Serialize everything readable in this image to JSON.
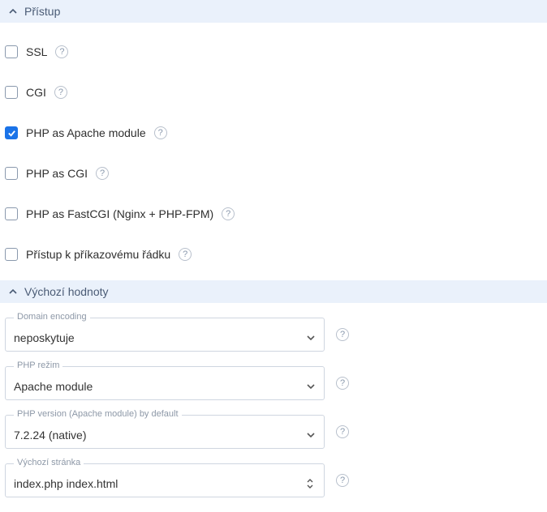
{
  "sections": {
    "access": {
      "title": "Přístup"
    },
    "defaults": {
      "title": "Výchozí hodnoty"
    }
  },
  "access_items": [
    {
      "label": "SSL",
      "checked": false
    },
    {
      "label": "CGI",
      "checked": false
    },
    {
      "label": "PHP as Apache module",
      "checked": true
    },
    {
      "label": "PHP as CGI",
      "checked": false
    },
    {
      "label": "PHP as FastCGI (Nginx + PHP-FPM)",
      "checked": false
    },
    {
      "label": "Přístup k příkazovému řádku",
      "checked": false
    }
  ],
  "defaults_fields": {
    "domain_encoding": {
      "label": "Domain encoding",
      "value": "neposkytuje"
    },
    "php_mode": {
      "label": "PHP režim",
      "value": "Apache module"
    },
    "php_version": {
      "label": "PHP version (Apache module) by default",
      "value": "7.2.24 (native)"
    },
    "default_page": {
      "label": "Výchozí stránka",
      "value": "index.php index.html"
    }
  },
  "colors": {
    "accent": "#1a73e8",
    "header_bg": "#eaf1fb"
  }
}
